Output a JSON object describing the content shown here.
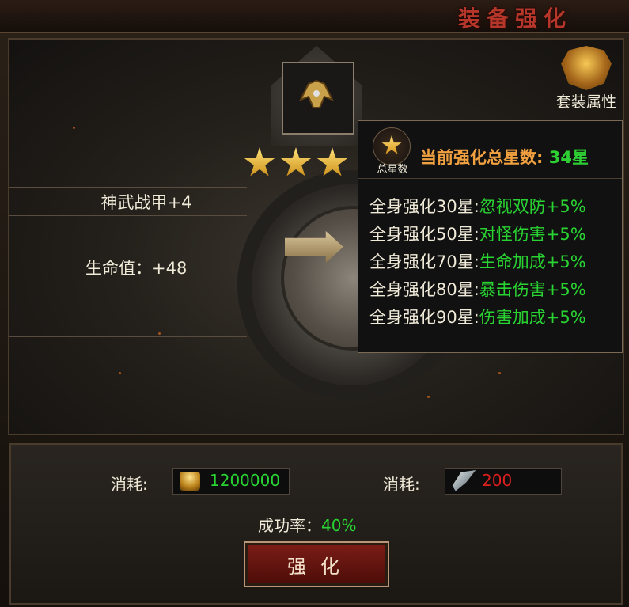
{
  "window": {
    "title": "装备强化"
  },
  "item": {
    "name": "神武战甲+4",
    "stat": "生命值：+48",
    "stars": 3
  },
  "set_bonus": {
    "label": "套装属性"
  },
  "tooltip": {
    "emblem_label": "总星数",
    "title_prefix": "当前强化总星数: ",
    "title_value": "34星",
    "rows": [
      {
        "label": "全身强化30星:",
        "value": "忽视双防+5%"
      },
      {
        "label": "全身强化50星:",
        "value": "对怪伤害+5%"
      },
      {
        "label": "全身强化70星:",
        "value": "生命加成+5%"
      },
      {
        "label": "全身强化80星:",
        "value": "暴击伤害+5%"
      },
      {
        "label": "全身强化90星:",
        "value": "伤害加成+5%"
      }
    ]
  },
  "cost": {
    "gold": {
      "label": "消耗:",
      "value": "1200000",
      "icon": "gold-coins-icon",
      "color": "#29d432"
    },
    "stone": {
      "label": "消耗:",
      "value": "200",
      "icon": "enhance-stone-icon",
      "color": "#e01e1e"
    }
  },
  "success": {
    "label": "成功率：",
    "value": "40%"
  },
  "button": {
    "label": "强化"
  },
  "colors": {
    "title": "#b6362a",
    "green": "#29d432",
    "orange": "#f1a040",
    "red": "#e01e1e"
  }
}
